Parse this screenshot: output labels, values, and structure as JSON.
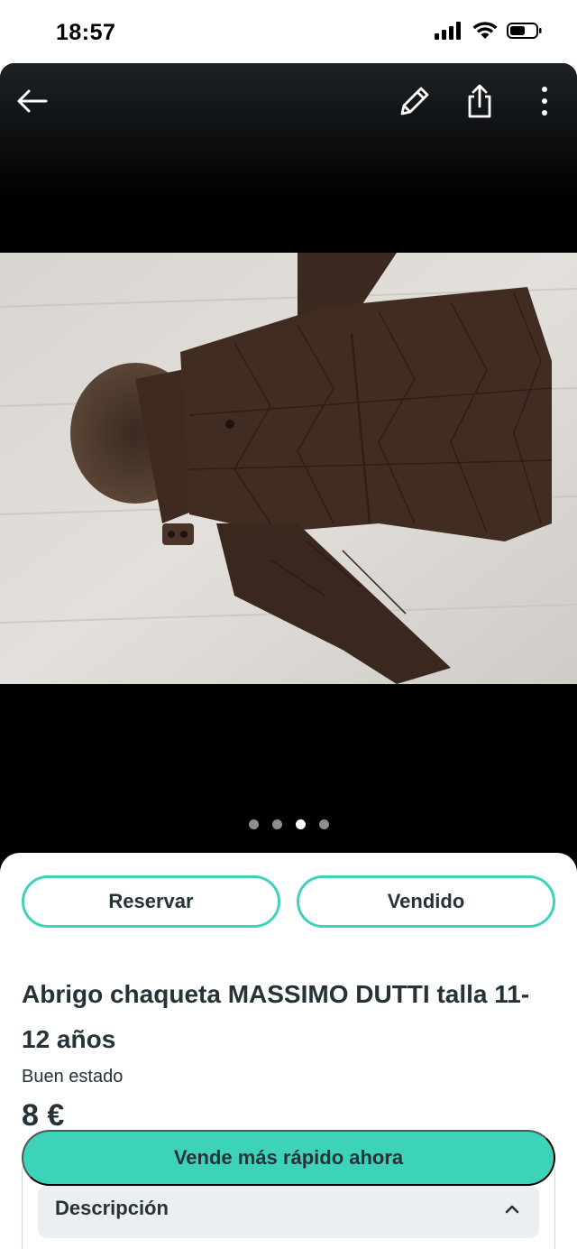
{
  "status_bar": {
    "time": "18:57"
  },
  "toolbar": {
    "back_icon": "arrow-left-icon",
    "edit_icon": "pencil-icon",
    "share_icon": "share-icon",
    "more_icon": "more-vertical-icon"
  },
  "gallery": {
    "photo_count": 4,
    "active_index": 2
  },
  "actions": {
    "reserve_label": "Reservar",
    "sold_label": "Vendido"
  },
  "product": {
    "title": "Abrigo chaqueta MASSIMO DUTTI talla 11-12 años",
    "condition": "Buen estado",
    "price": "8 €"
  },
  "description": {
    "label": "Descripción"
  },
  "cta": {
    "label": "Vende más rápido ahora"
  },
  "colors": {
    "accent": "#3dd2ba",
    "text": "#253238"
  }
}
